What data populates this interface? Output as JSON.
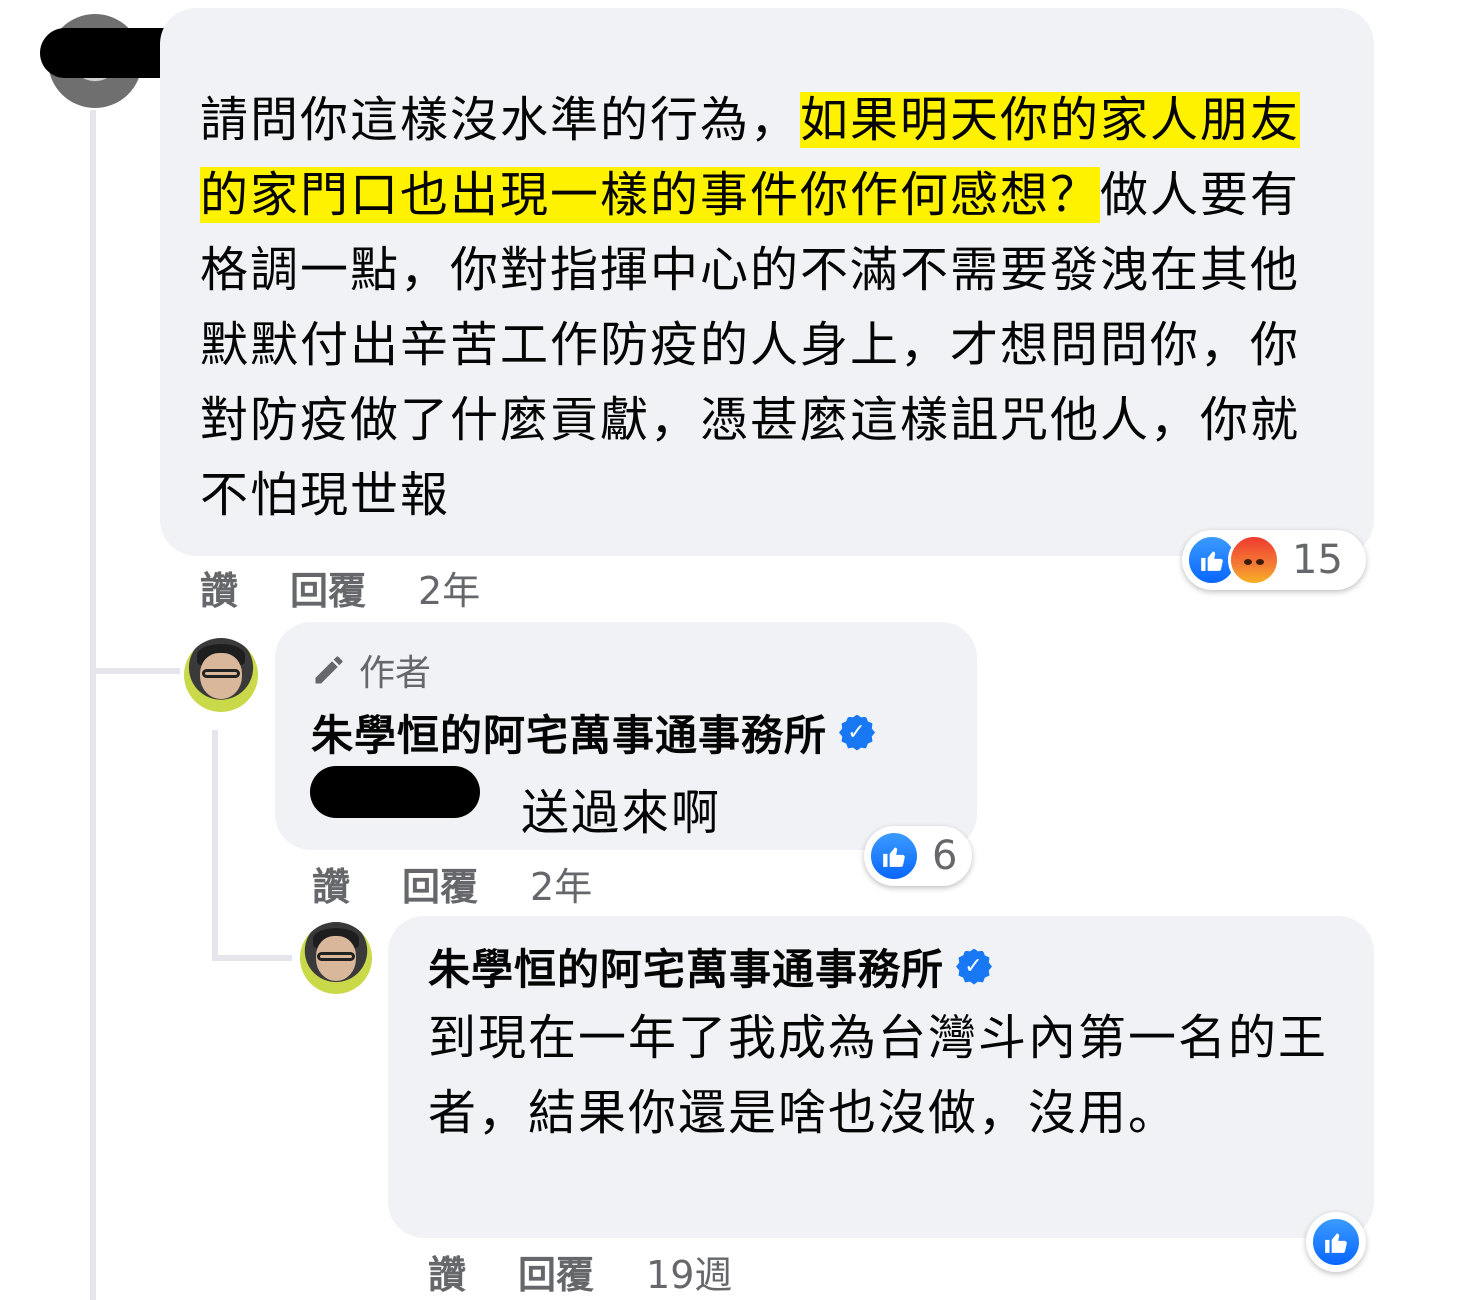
{
  "comment1": {
    "text_plain_1": "請問你這樣沒水準的行為，",
    "text_highlight": "如果明天你的家人朋友的家門口也出現一樣的事件你作何感想？",
    "text_plain_2": "做人要有格調一點，你對指揮中心的不滿不需要發洩在其他默默付出辛苦工作防疫的人身上，才想問問你，你對防疫做了什麼貢獻，憑甚麼這樣詛咒他人，你就不怕現世報",
    "reaction_count": "15",
    "actions": {
      "like": "讚",
      "reply": "回覆",
      "time": "2年"
    }
  },
  "reply1": {
    "author_badge": "作者",
    "author_name": "朱學恒的阿宅萬事通事務所",
    "text": "送過來啊",
    "reaction_count": "6",
    "actions": {
      "like": "讚",
      "reply": "回覆",
      "time": "2年"
    }
  },
  "reply2": {
    "author_name": "朱學恒的阿宅萬事通事務所",
    "text": "到現在一年了我成為台灣斗內第一名的王者，結果你還是啥也沒做，沒用。",
    "actions": {
      "like": "讚",
      "reply": "回覆",
      "time": "19週"
    }
  },
  "icons": {
    "verified": "verified-badge-icon",
    "author_pencil": "pencil-icon",
    "like_reaction": "like-reaction-icon",
    "angry_reaction": "angry-reaction-icon"
  },
  "colors": {
    "bubble_bg": "#f0f2f5",
    "highlight": "#fff200",
    "facebook_blue": "#1877f2",
    "meta_text": "#65676b"
  }
}
